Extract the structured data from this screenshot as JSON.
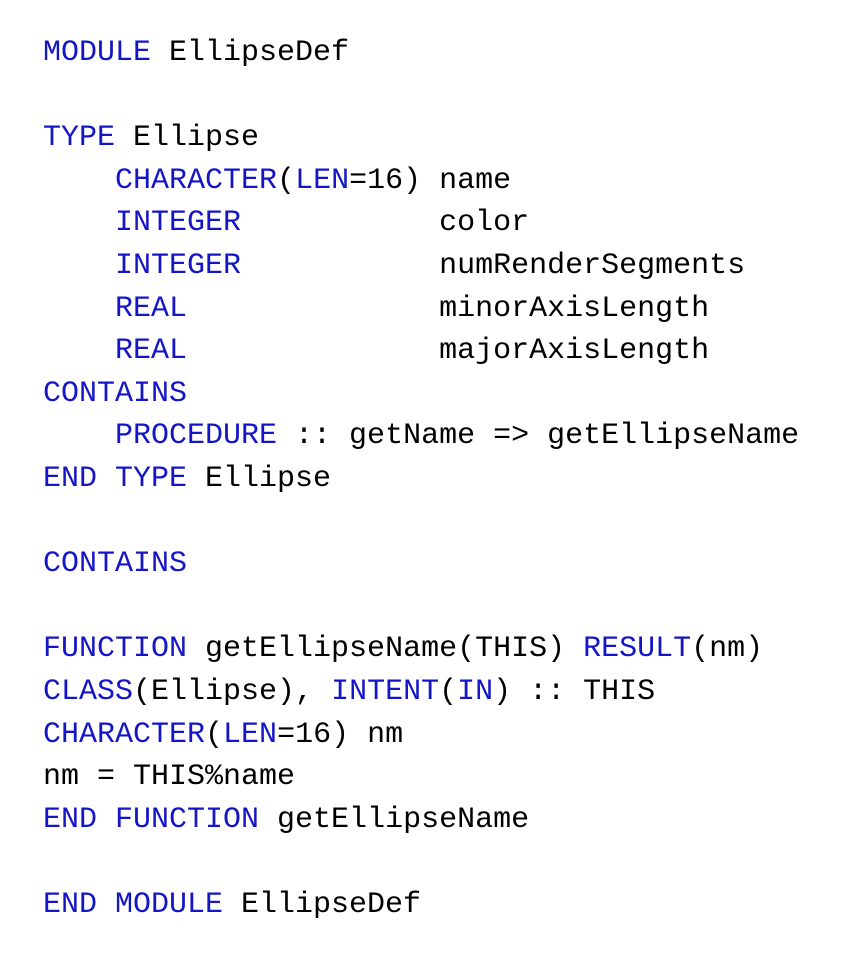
{
  "colors": {
    "keyword": "#1515c8",
    "text": "#000000",
    "background": "#ffffff"
  },
  "lines": [
    [
      {
        "t": "kw",
        "v": "MODULE"
      },
      {
        "t": "id",
        "v": " EllipseDef"
      }
    ],
    [],
    [
      {
        "t": "kw",
        "v": "TYPE"
      },
      {
        "t": "id",
        "v": " Ellipse"
      }
    ],
    [
      {
        "t": "id",
        "v": "    "
      },
      {
        "t": "kw",
        "v": "CHARACTER"
      },
      {
        "t": "id",
        "v": "("
      },
      {
        "t": "kw",
        "v": "LEN"
      },
      {
        "t": "id",
        "v": "=16) name"
      }
    ],
    [
      {
        "t": "id",
        "v": "    "
      },
      {
        "t": "kw",
        "v": "INTEGER"
      },
      {
        "t": "id",
        "v": "           color"
      }
    ],
    [
      {
        "t": "id",
        "v": "    "
      },
      {
        "t": "kw",
        "v": "INTEGER"
      },
      {
        "t": "id",
        "v": "           numRenderSegments"
      }
    ],
    [
      {
        "t": "id",
        "v": "    "
      },
      {
        "t": "kw",
        "v": "REAL"
      },
      {
        "t": "id",
        "v": "              minorAxisLength"
      }
    ],
    [
      {
        "t": "id",
        "v": "    "
      },
      {
        "t": "kw",
        "v": "REAL"
      },
      {
        "t": "id",
        "v": "              majorAxisLength"
      }
    ],
    [
      {
        "t": "kw",
        "v": "CONTAINS"
      }
    ],
    [
      {
        "t": "id",
        "v": "    "
      },
      {
        "t": "kw",
        "v": "PROCEDURE"
      },
      {
        "t": "id",
        "v": " :: getName => getEllipseName"
      }
    ],
    [
      {
        "t": "kw",
        "v": "END TYPE"
      },
      {
        "t": "id",
        "v": " Ellipse"
      }
    ],
    [],
    [
      {
        "t": "kw",
        "v": "CONTAINS"
      }
    ],
    [],
    [
      {
        "t": "kw",
        "v": "FUNCTION"
      },
      {
        "t": "id",
        "v": " getEllipseName(THIS) "
      },
      {
        "t": "kw",
        "v": "RESULT"
      },
      {
        "t": "id",
        "v": "(nm)"
      }
    ],
    [
      {
        "t": "kw",
        "v": "CLASS"
      },
      {
        "t": "id",
        "v": "(Ellipse), "
      },
      {
        "t": "kw",
        "v": "INTENT"
      },
      {
        "t": "id",
        "v": "("
      },
      {
        "t": "kw",
        "v": "IN"
      },
      {
        "t": "id",
        "v": ") :: THIS"
      }
    ],
    [
      {
        "t": "kw",
        "v": "CHARACTER"
      },
      {
        "t": "id",
        "v": "("
      },
      {
        "t": "kw",
        "v": "LEN"
      },
      {
        "t": "id",
        "v": "=16) nm"
      }
    ],
    [
      {
        "t": "id",
        "v": "nm = THIS%name"
      }
    ],
    [
      {
        "t": "kw",
        "v": "END FUNCTION"
      },
      {
        "t": "id",
        "v": " getEllipseName"
      }
    ],
    [],
    [
      {
        "t": "kw",
        "v": "END MODULE"
      },
      {
        "t": "id",
        "v": " EllipseDef"
      }
    ]
  ]
}
